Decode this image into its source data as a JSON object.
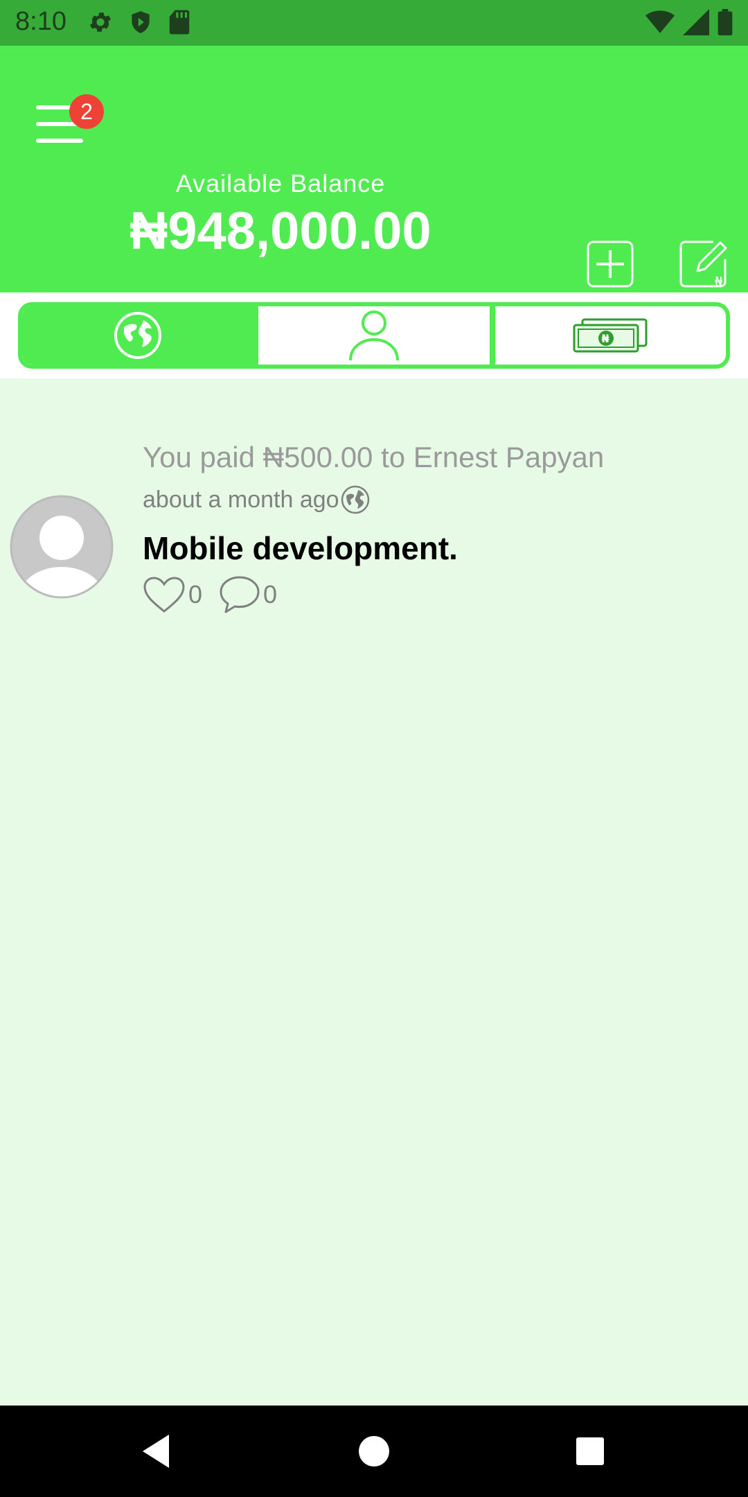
{
  "status_bar": {
    "time": "8:10",
    "left_icons": [
      "gear-icon",
      "shield-icon",
      "sd-card-icon"
    ],
    "right_icons": [
      "wifi-icon",
      "signal-icon",
      "battery-icon"
    ]
  },
  "header": {
    "menu_badge": "2",
    "balance_label": "Available Balance",
    "balance_value": "₦948,000.00",
    "actions": [
      "add-funds-icon",
      "edit-naira-icon"
    ]
  },
  "tabs": [
    {
      "name": "global",
      "icon": "globe-icon",
      "active": true
    },
    {
      "name": "personal",
      "icon": "user-icon",
      "active": false
    },
    {
      "name": "money",
      "icon": "naira-money-icon",
      "active": false
    }
  ],
  "feed": [
    {
      "description": "You paid ₦500.00 to Ernest Papyan",
      "time": "about a month ago",
      "note": "Mobile development.",
      "likes": "0",
      "comments": "0"
    }
  ],
  "colors": {
    "status_bar": "#37ab37",
    "primary": "#50eb50",
    "background": "#e6fae6",
    "badge": "#ee4236"
  }
}
